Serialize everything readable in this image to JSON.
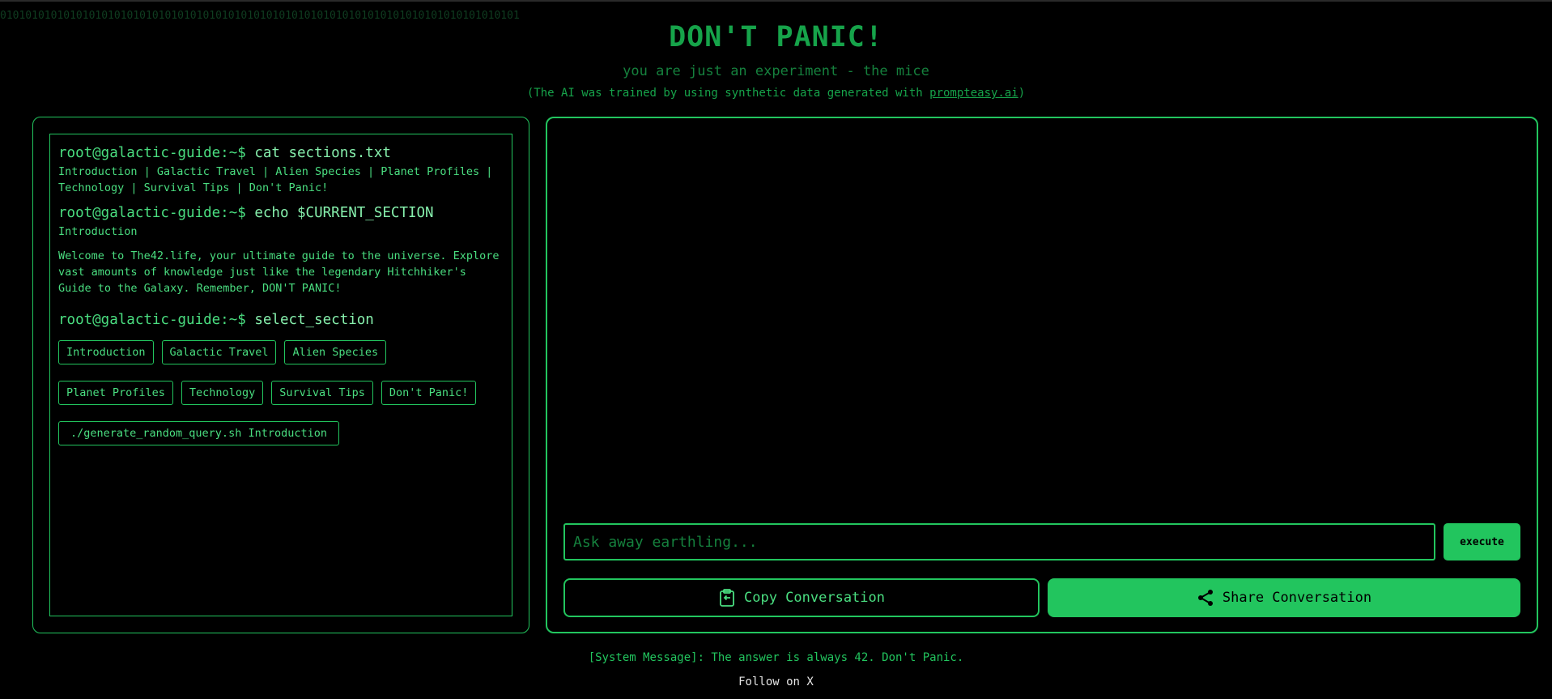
{
  "binary_strip": "0101010101010101010101010101010101010101010101010101010101010101010101010101010101",
  "header": {
    "title": "DON'T PANIC!",
    "subtitle": "you are just an experiment - the mice",
    "credit_prefix": "(The AI was trained by using synthetic data generated with ",
    "credit_link": "prompteasy.ai",
    "credit_suffix": ")"
  },
  "terminal": {
    "prompt": "root@galactic-guide:~$",
    "cmd_sections": "cat sections.txt",
    "sections_output": "Introduction | Galactic Travel | Alien Species | Planet Profiles | Technology | Survival Tips | Don't Panic!",
    "cmd_current": "echo $CURRENT_SECTION",
    "current_section": "Introduction",
    "welcome_text": "Welcome to The42.life, your ultimate guide to the universe. Explore vast amounts of knowledge just like the legendary Hitchhiker's Guide to the Galaxy. Remember, DON'T PANIC!",
    "cmd_select": "select_section",
    "section_buttons": [
      "Introduction",
      "Galactic Travel",
      "Alien Species",
      "Planet Profiles",
      "Technology",
      "Survival Tips",
      "Don't Panic!"
    ],
    "generate_button": "./generate_random_query.sh Introduction"
  },
  "chat": {
    "input_placeholder": "Ask away earthling...",
    "input_value": "",
    "execute_label": "execute",
    "copy_label": "Copy Conversation",
    "share_label": "Share Conversation"
  },
  "footer": {
    "system_message": "[System Message]: The answer is always 42. Don't Panic.",
    "follow_prefix": "Follow on ",
    "follow_link": "X"
  },
  "colors": {
    "accent": "#22c55e",
    "background": "#000000"
  }
}
